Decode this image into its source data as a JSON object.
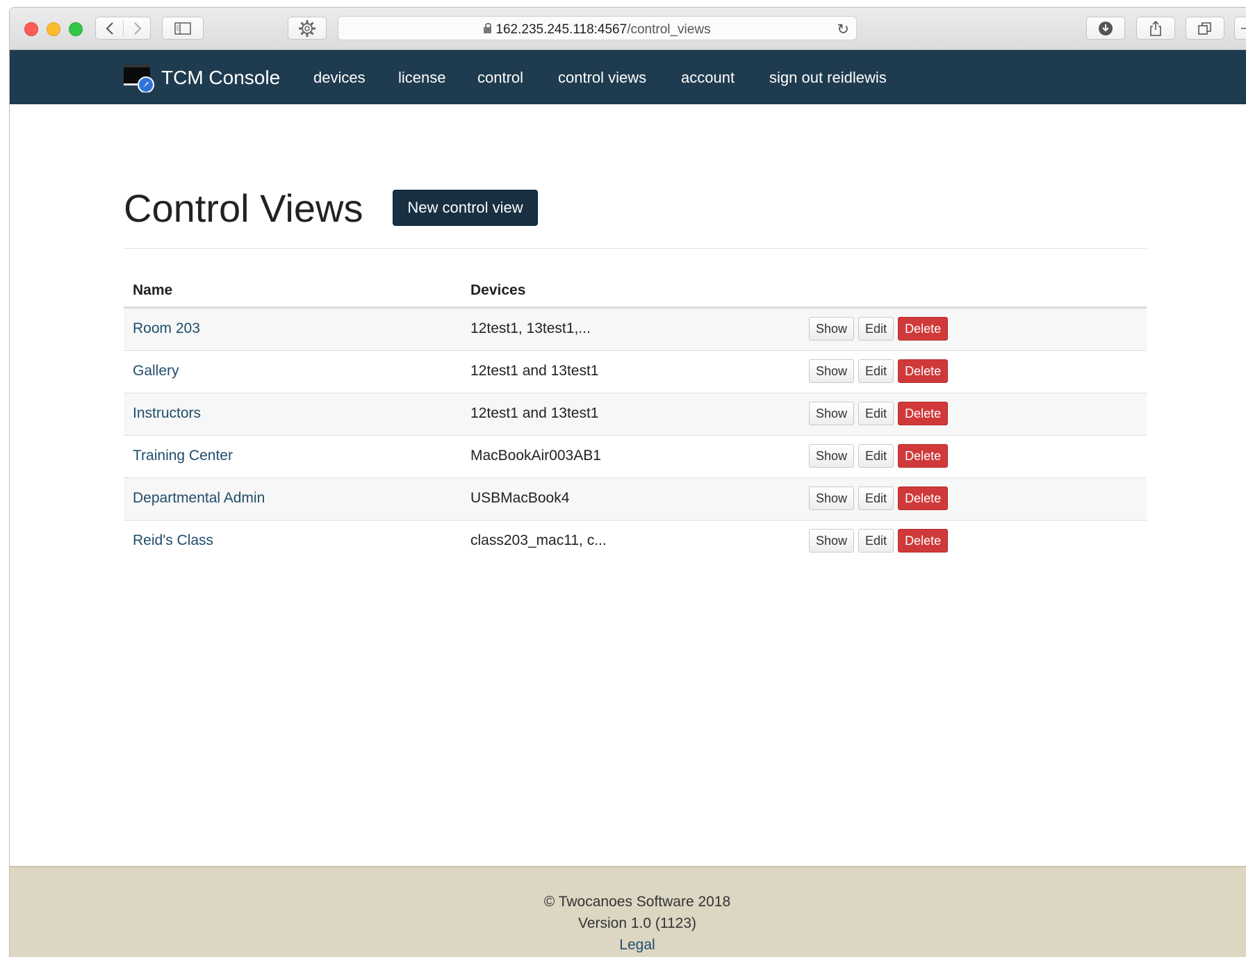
{
  "browser": {
    "url_host": "162.235.245.118:4567",
    "url_path": "/control_views"
  },
  "navbar": {
    "brand": "TCM Console",
    "items": [
      "devices",
      "license",
      "control",
      "control views",
      "account",
      "sign out reidlewis"
    ]
  },
  "page": {
    "title": "Control Views",
    "new_button": "New control view"
  },
  "table": {
    "headers": [
      "Name",
      "Devices"
    ],
    "rows": [
      {
        "name": "Room 203",
        "devices": "12test1, 13test1,..."
      },
      {
        "name": "Gallery",
        "devices": "12test1 and 13test1"
      },
      {
        "name": "Instructors",
        "devices": "12test1 and 13test1"
      },
      {
        "name": "Training Center",
        "devices": "MacBookAir003AB1"
      },
      {
        "name": "Departmental Admin",
        "devices": "USBMacBook4"
      },
      {
        "name": "Reid's Class",
        "devices": "class203_mac11, c..."
      }
    ],
    "actions": {
      "show": "Show",
      "edit": "Edit",
      "delete": "Delete"
    }
  },
  "footer": {
    "copyright": "© Twocanoes Software 2018",
    "version": "Version 1.0 (1123)",
    "legal": "Legal"
  },
  "colors": {
    "navbar": "#1f3b4f",
    "primary_button": "#183042",
    "danger": "#d0393a",
    "link": "#1f4d6b",
    "footer": "#dcd6c2"
  }
}
